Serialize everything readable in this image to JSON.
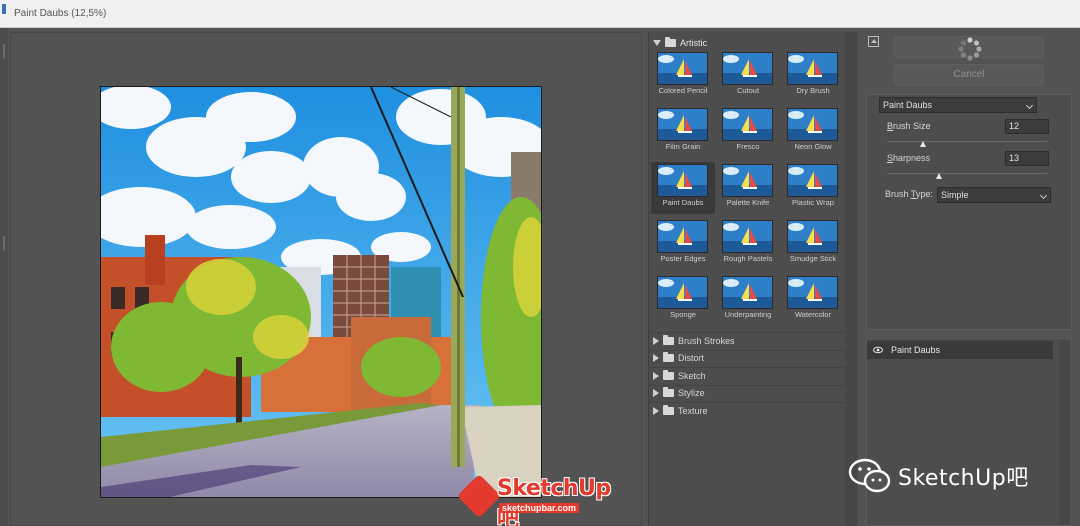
{
  "window": {
    "title": "Paint Daubs (12,5%)"
  },
  "gallery": {
    "open_category": "Artistic",
    "filters": [
      {
        "label": "Colored Pencil"
      },
      {
        "label": "Cutout"
      },
      {
        "label": "Dry Brush"
      },
      {
        "label": "Film Grain"
      },
      {
        "label": "Fresco"
      },
      {
        "label": "Neon Glow"
      },
      {
        "label": "Paint Daubs",
        "selected": true
      },
      {
        "label": "Palette Knife"
      },
      {
        "label": "Plastic Wrap"
      },
      {
        "label": "Poster Edges"
      },
      {
        "label": "Rough Pastels"
      },
      {
        "label": "Smudge Stick"
      },
      {
        "label": "Sponge"
      },
      {
        "label": "Underpainting"
      },
      {
        "label": "Watercolor"
      }
    ],
    "collapsed_categories": [
      "Brush Strokes",
      "Distort",
      "Sketch",
      "Stylize",
      "Texture"
    ]
  },
  "controls": {
    "cancel_label": "Cancel",
    "filter_select": "Paint Daubs",
    "brush_size": {
      "label_pre": "",
      "label_u": "B",
      "label_post": "rush Size",
      "value": "12",
      "min": 1,
      "max": 50
    },
    "sharpness": {
      "label_pre": "",
      "label_u": "S",
      "label_post": "harpness",
      "value": "13",
      "min": 0,
      "max": 40
    },
    "brush_type": {
      "label_pre": "Brush ",
      "label_u": "T",
      "label_post": "ype:",
      "value": "Simple"
    }
  },
  "layers": {
    "items": [
      {
        "name": "Paint Daubs"
      }
    ]
  },
  "watermarks": {
    "logo_text": "SketchUp吧",
    "logo_url": "sketchupbar.com",
    "wechat_text": "SketchUp吧"
  },
  "colors": {
    "accent_red": "#e23a2c",
    "panel_bg": "#535353",
    "sky": "#3aa6e8"
  },
  "icons": {
    "eye": "eye-icon",
    "folder": "folder-icon",
    "collapse": "collapse-panel-icon",
    "spinner": "loading-spinner-icon"
  }
}
